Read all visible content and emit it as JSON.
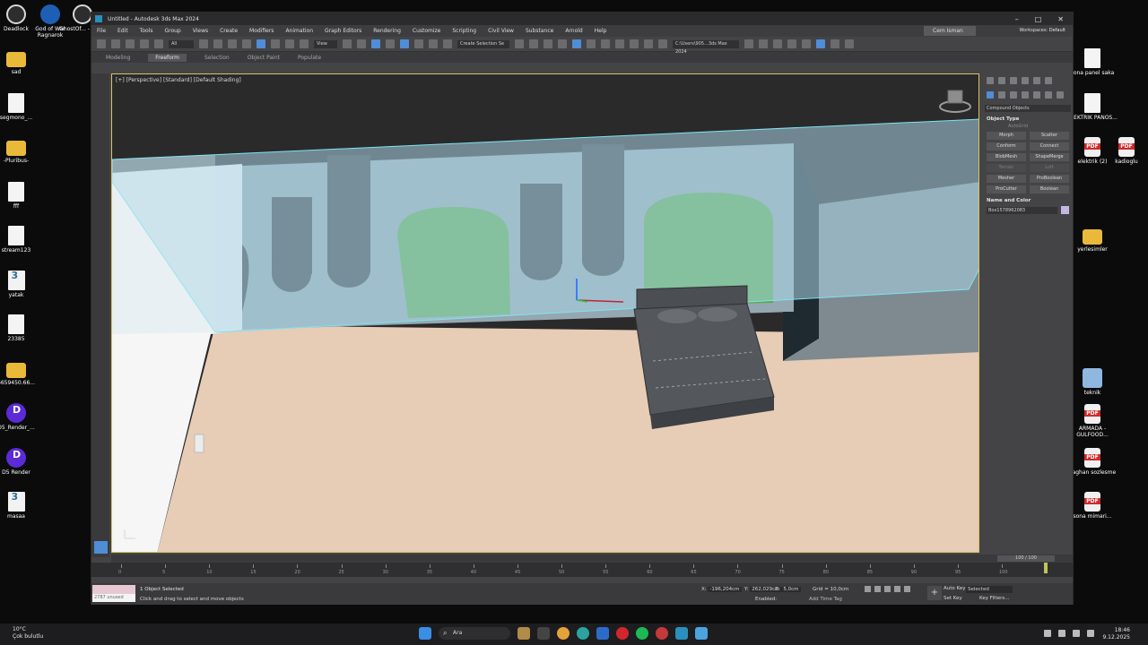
{
  "desktop_left": [
    {
      "label": "Deadlock",
      "kind": "app"
    },
    {
      "label": "God of War Ragnarok",
      "kind": "gow"
    },
    {
      "label": "GhostOf... - Kisay",
      "kind": "app"
    },
    {
      "label": "sad",
      "kind": "folder"
    },
    {
      "label": "segmono_...",
      "kind": "doc"
    },
    {
      "label": "-Pluribus-",
      "kind": "folder"
    },
    {
      "label": "fff",
      "kind": "doc"
    },
    {
      "label": "stream123",
      "kind": "doc"
    },
    {
      "label": "yatak",
      "kind": "max"
    },
    {
      "label": "23385",
      "kind": "doc"
    },
    {
      "label": "6659450.66...",
      "kind": "folder"
    },
    {
      "label": "D5_Render_...",
      "kind": "d5"
    },
    {
      "label": "D5 Render",
      "kind": "d5"
    },
    {
      "label": "masaa",
      "kind": "max"
    }
  ],
  "desktop_right": [
    {
      "label": "sona panel saka",
      "kind": "doc"
    },
    {
      "label": "ELEKTRIK PANOS...",
      "kind": "doc"
    },
    {
      "label": "elektrik (2)",
      "kind": "pdf"
    },
    {
      "label": "kadioglu",
      "kind": "pdf"
    },
    {
      "label": "yerlesimler",
      "kind": "folder"
    },
    {
      "label": "teknik",
      "kind": "img"
    },
    {
      "label": "ARMADA - GULFOOD...",
      "kind": "pdf"
    },
    {
      "label": "baghan sozlesme",
      "kind": "pdf"
    },
    {
      "label": "sona mimari...",
      "kind": "pdf"
    }
  ],
  "window": {
    "title": "Untitled - Autodesk 3ds Max 2024",
    "controls": [
      "–",
      "□",
      "✕"
    ]
  },
  "menu": [
    "File",
    "Edit",
    "Tools",
    "Group",
    "Views",
    "Create",
    "Modifiers",
    "Animation",
    "Graph Editors",
    "Rendering",
    "Customize",
    "Scripting",
    "Civil View",
    "Substance",
    "Arnold",
    "Help"
  ],
  "user": "Cem Isman",
  "workspace": {
    "label": "Workspaces:",
    "value": "Default"
  },
  "toolbar": {
    "filter": "All",
    "view": "View",
    "selection_set": "Create Selection Se",
    "path": "C:\\Users\\905...3ds Max 2024"
  },
  "ribbon": [
    "Modeling",
    "Freeform",
    "Selection",
    "Object Paint",
    "Populate"
  ],
  "ribbon_active": "Freeform",
  "viewport_label": "[+] [Perspective] [Standard] [Default Shading]",
  "command_panel": {
    "category": "Compound Objects",
    "object_type_title": "Object Type",
    "autogrid": "AutoGrid",
    "buttons": [
      {
        "label": "Morph",
        "enabled": true
      },
      {
        "label": "Scatter",
        "enabled": true
      },
      {
        "label": "Conform",
        "enabled": true
      },
      {
        "label": "Connect",
        "enabled": true
      },
      {
        "label": "BlobMesh",
        "enabled": true
      },
      {
        "label": "ShapeMerge",
        "enabled": true
      },
      {
        "label": "Terrain",
        "enabled": false
      },
      {
        "label": "Loft",
        "enabled": false
      },
      {
        "label": "Mesher",
        "enabled": true
      },
      {
        "label": "ProBoolean",
        "enabled": true
      },
      {
        "label": "ProCutter",
        "enabled": true
      },
      {
        "label": "Boolean",
        "enabled": true
      }
    ],
    "name_color_title": "Name and Color",
    "object_name": "Box1578962083",
    "object_color": "#c5b7e3"
  },
  "timeline": {
    "frame_display": "100 / 100",
    "ticks": [
      "0",
      "5",
      "10",
      "15",
      "20",
      "25",
      "30",
      "35",
      "40",
      "45",
      "50",
      "55",
      "60",
      "65",
      "70",
      "75",
      "80",
      "85",
      "90",
      "95",
      "100"
    ]
  },
  "status": {
    "maxscript_text": "2787 unused",
    "selected": "1 Object Selected",
    "prompt": "Click and drag to select and move objects",
    "x": "-196,204cm",
    "y": "262,029cm",
    "z": "5,0cm",
    "grid": "Grid = 10,0cm",
    "enabled": "Enabled:",
    "add_time_tag": "Add Time Tag",
    "auto_key": "Auto Key",
    "set_key": "Set Key",
    "selected_mode": "Selected",
    "key_filters": "Key Filters...",
    "frame": "100"
  },
  "taskbar": {
    "weather_temp": "10°C",
    "weather_desc": "Çok bulutlu",
    "search": "Ara",
    "time": "18:46",
    "date": "9.12.2025"
  },
  "colors": {
    "accent": "#4f8dd6",
    "green_panel": "#5aa84a",
    "floor": "#e7ccb6",
    "glass": "#a9d3e6",
    "wall_gray": "#7a8b93",
    "bed": "#4b4e52"
  }
}
